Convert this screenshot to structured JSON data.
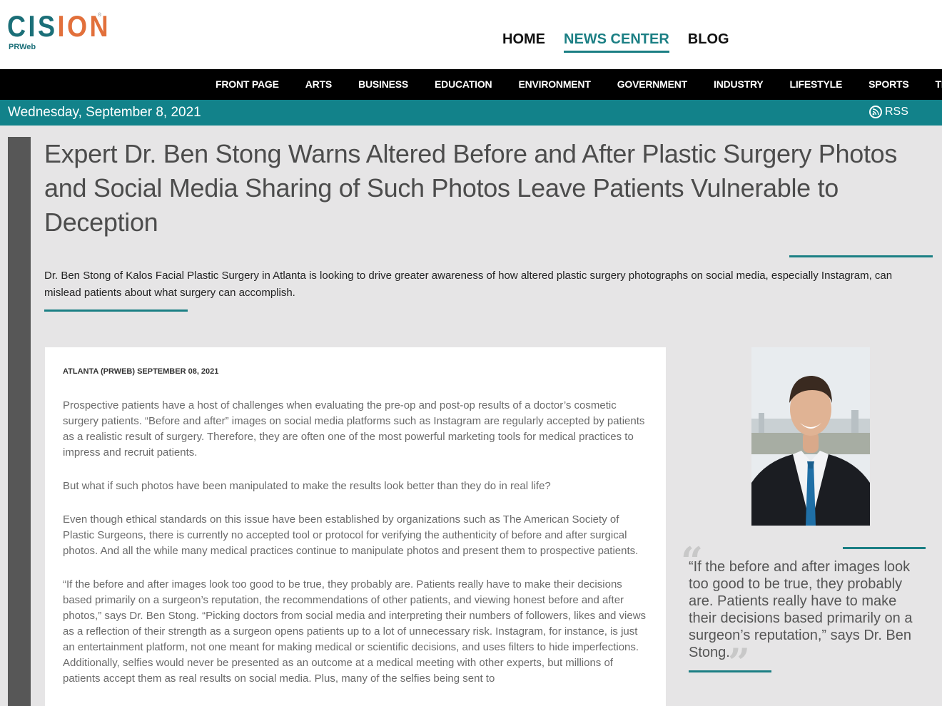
{
  "brand": {
    "logo_left": "CIS",
    "logo_right": "ION",
    "logo_sub": "PRWeb",
    "logo_tm": "®"
  },
  "topnav": [
    {
      "label": "HOME",
      "active": false
    },
    {
      "label": "NEWS CENTER",
      "active": true
    },
    {
      "label": "BLOG",
      "active": false
    }
  ],
  "categories": [
    "FRONT PAGE",
    "ARTS",
    "BUSINESS",
    "EDUCATION",
    "ENVIRONMENT",
    "GOVERNMENT",
    "INDUSTRY",
    "LIFESTYLE",
    "SPORTS",
    "TECH"
  ],
  "datebar": {
    "date": "Wednesday, September 8, 2021",
    "rss_label": "RSS"
  },
  "article": {
    "headline_1": "Expert Dr. Ben Stong Warns Altered Before and After Plastic Surgery Photos",
    "headline_2": "and Social Media Sharing of Such Photos Leave Patients Vulnerable to",
    "headline_3": "Deception",
    "summary": "Dr. Ben Stong of Kalos Facial Plastic Surgery in Atlanta is looking to drive greater awareness of how altered plastic surgery photographs on social media, especially Instagram, can mislead patients about what surgery can accomplish.",
    "dateline": "ATLANTA (PRWEB) SEPTEMBER 08, 2021",
    "paragraphs": [
      "Prospective patients have a host of challenges when evaluating the pre-op and post-op results of a doctor’s cosmetic surgery patients. “Before and after” images on social media platforms such as Instagram are regularly accepted by patients as a realistic result of surgery. Therefore, they are often one of the most powerful marketing tools for medical practices to impress and recruit patients.",
      "But what if such photos have been manipulated to make the results look better than they do in real life?",
      "Even though ethical standards on this issue have been established by organizations such as The American Society of Plastic Surgeons, there is currently no accepted tool or protocol for verifying the authenticity of before and after surgical photos. And all the while many medical practices continue to manipulate photos and present them to prospective patients.",
      "“If the before and after images look too good to be true, they probably are. Patients really have to make their decisions based primarily on a surgeon’s reputation, the recommendations of other patients, and viewing honest before and after photos,” says Dr. Ben Stong. “Picking doctors from social media and interpreting their numbers of followers, likes and views as a reflection of their strength as a surgeon opens patients up to a lot of unnecessary risk. Instagram, for instance, is just an entertainment platform, not one meant for making medical or scientific decisions, and uses filters to hide imperfections. Additionally, selfies would never be presented as an outcome at a medical meeting with other experts, but millions of patients accept them as real results on social media. Plus, many of the selfies being sent to"
    ]
  },
  "sidebar": {
    "quote": "“If the before and after images look too good to be true, they probably are. Patients really have to make their decisions based primarily on a surgeon’s reputation,” says Dr. Ben Stong."
  },
  "colors": {
    "teal": "#12828a",
    "accent": "#1b7f84",
    "orange": "#e2703b",
    "black_bar": "#000000",
    "page_bg": "#e6e5e6"
  }
}
